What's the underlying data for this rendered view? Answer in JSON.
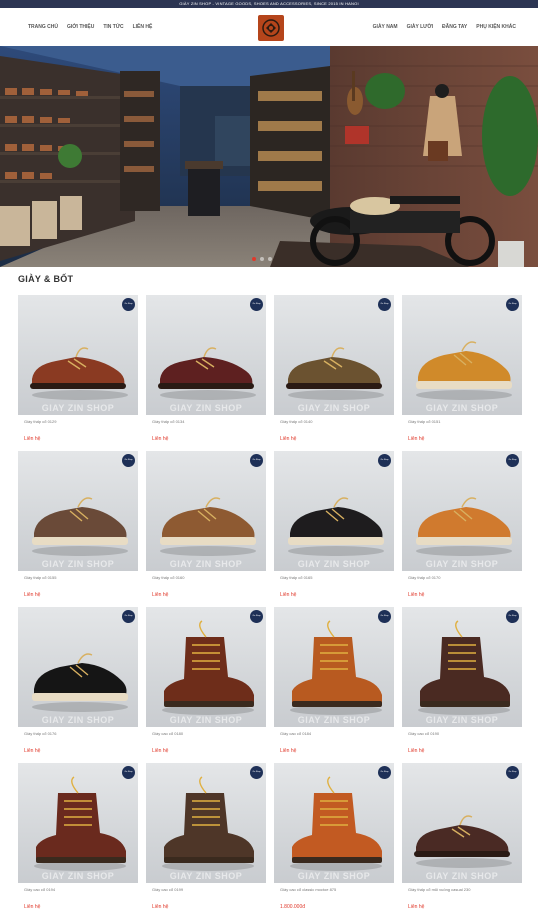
{
  "topbar": {
    "text": "GIÀY ZIN SHOP - VINTAGE GOODS, SHOES AND ACCESSORIES, SINCE 2015 IN HANOI"
  },
  "nav": {
    "left": [
      "TRANG CHỦ",
      "GIỚI THIỆU",
      "TIN TỨC",
      "LIÊN HỆ"
    ],
    "right": [
      "GIÀY NAM",
      "GIÀY LƯỜI",
      "ĐĂNG TAY",
      "PHỤ KIỆN KHÁC"
    ]
  },
  "section": {
    "title": "GIÀY & BỐT"
  },
  "watermark": "GIAY ZIN SHOP",
  "badge": "Zin Shop",
  "products": [
    {
      "name": "Giày thấp cổ 0129",
      "price": "Liên hệ",
      "color": "#8a3a22",
      "type": "low"
    },
    {
      "name": "Giày thấp cổ 0134",
      "price": "Liên hệ",
      "color": "#5e2020",
      "type": "low"
    },
    {
      "name": "Giày thấp cổ 0140",
      "price": "Liên hệ",
      "color": "#6b5230",
      "type": "low"
    },
    {
      "name": "Giày thấp cổ 0151",
      "price": "Liên hệ",
      "color": "#d08a2a",
      "type": "moc"
    },
    {
      "name": "Giày thấp cổ 0155",
      "price": "Liên hệ",
      "color": "#6a4a38",
      "type": "moc"
    },
    {
      "name": "Giày thấp cổ 0160",
      "price": "Liên hệ",
      "color": "#8e5a32",
      "type": "moc"
    },
    {
      "name": "Giày thấp cổ 0165",
      "price": "Liên hệ",
      "color": "#1e1c1e",
      "type": "moc"
    },
    {
      "name": "Giày thấp cổ 0170",
      "price": "Liên hệ",
      "color": "#d07a2e",
      "type": "moc"
    },
    {
      "name": "Giày thấp cổ 0176",
      "price": "Liên hệ",
      "color": "#151515",
      "type": "moc"
    },
    {
      "name": "Giày cao cổ 0180",
      "price": "Liên hệ",
      "color": "#6e2d1a",
      "type": "boot"
    },
    {
      "name": "Giày cao cổ 0184",
      "price": "Liên hệ",
      "color": "#b85a20",
      "type": "boot"
    },
    {
      "name": "Giày cao cổ 0190",
      "price": "Liên hệ",
      "color": "#4a2a22",
      "type": "boot"
    },
    {
      "name": "Giày cao cổ 0194",
      "price": "Liên hệ",
      "color": "#6a2a1e",
      "type": "boot"
    },
    {
      "name": "Giày cao cổ 0199",
      "price": "Liên hệ",
      "color": "#4e3628",
      "type": "boot"
    },
    {
      "name": "Giày cao cổ classic moctoe 875",
      "price": "1.800.000đ",
      "color": "#c25a22",
      "type": "boot"
    },
    {
      "name": "Giày thấp cổ mũi vuông casual 230",
      "price": "Liên hệ",
      "color": "#4a2a24",
      "type": "low"
    }
  ]
}
